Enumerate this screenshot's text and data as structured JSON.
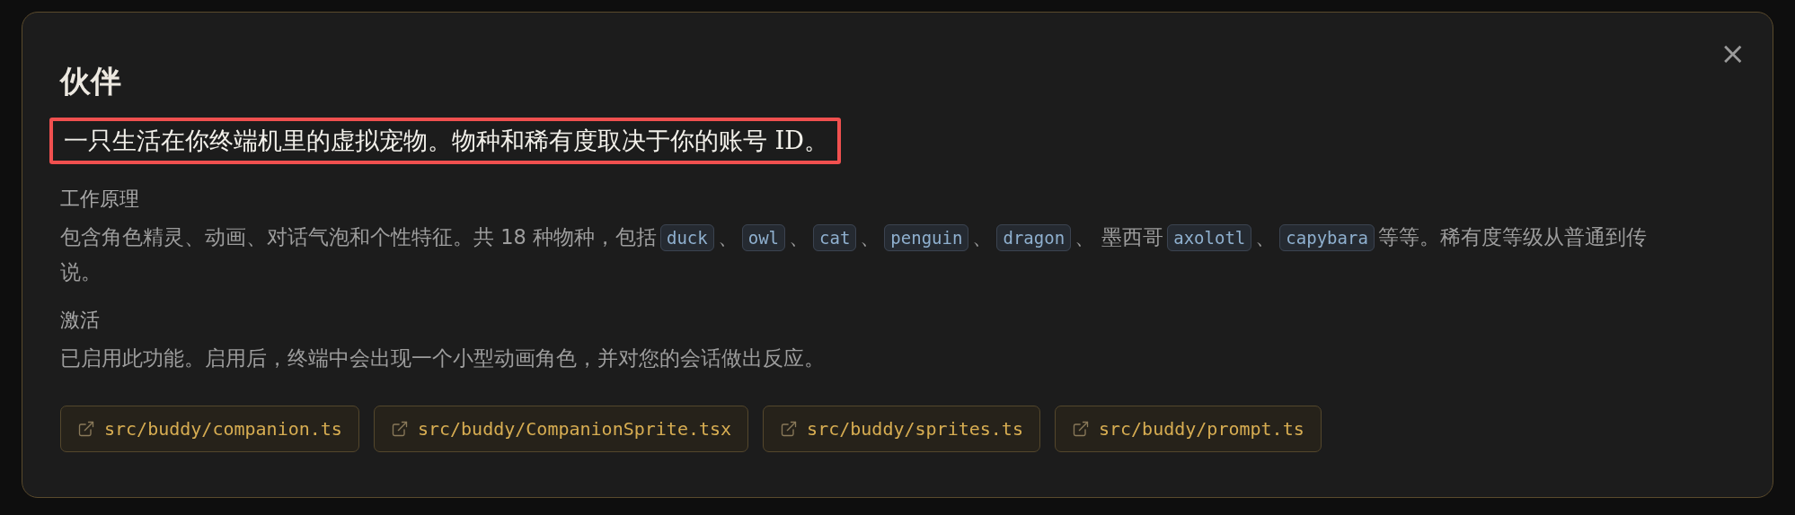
{
  "dialog": {
    "title": "伙伴",
    "close": "×",
    "subtitle": {
      "text": "一只生活在你终端机里的虚拟宠物。物种和稀有度取决于你的账号 ID。",
      "highlighted": true
    },
    "sections": [
      {
        "heading": "工作原理",
        "segments": [
          {
            "kind": "text",
            "text": "包含角色精灵、动画、对话气泡和个性特征。共 18 种物种，包括"
          },
          {
            "kind": "code",
            "text": "duck"
          },
          {
            "kind": "text",
            "text": "、"
          },
          {
            "kind": "code",
            "text": "owl"
          },
          {
            "kind": "text",
            "text": "、"
          },
          {
            "kind": "code",
            "text": "cat"
          },
          {
            "kind": "text",
            "text": "、"
          },
          {
            "kind": "code",
            "text": "penguin"
          },
          {
            "kind": "text",
            "text": "、"
          },
          {
            "kind": "code",
            "text": "dragon"
          },
          {
            "kind": "text",
            "text": "、 墨西哥"
          },
          {
            "kind": "code",
            "text": "axolotl"
          },
          {
            "kind": "text",
            "text": "、"
          },
          {
            "kind": "code",
            "text": "capybara"
          },
          {
            "kind": "text",
            "text": "等等。稀有度等级从普通到传"
          },
          {
            "kind": "line",
            "text": "说。"
          }
        ]
      },
      {
        "heading": "激活",
        "segments": [
          {
            "kind": "text",
            "text": "已启用此功能。启用后，终端中会出现一个小型动画角色，并对您的会话做出反应。"
          }
        ]
      }
    ],
    "files": [
      "src/buddy/companion.ts",
      "src/buddy/CompanionSprite.tsx",
      "src/buddy/sprites.ts",
      "src/buddy/prompt.ts"
    ]
  }
}
